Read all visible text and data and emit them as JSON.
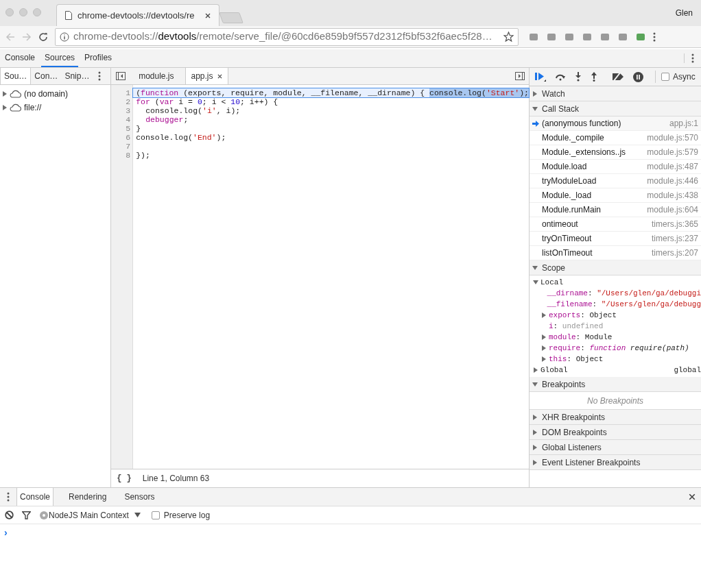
{
  "browser": {
    "tab_title": "chrome-devtools://devtools/re",
    "user": "Glen",
    "url": {
      "scheme": "chrome-devtools://",
      "host": "devtools",
      "path": "/remote/serve_file/@60cd6e859b9f557d2312f5bf532f6aec5f28…"
    }
  },
  "devtools_tabs": [
    {
      "label": "Console",
      "selected": false
    },
    {
      "label": "Sources",
      "selected": true
    },
    {
      "label": "Profiles",
      "selected": false
    }
  ],
  "navigator": {
    "tabs": [
      {
        "label": "Sou…",
        "selected": true
      },
      {
        "label": "Con…",
        "selected": false
      },
      {
        "label": "Snip…",
        "selected": false
      }
    ],
    "tree": [
      {
        "label": "(no domain)",
        "expanded": false
      },
      {
        "label": "file://",
        "expanded": false
      }
    ]
  },
  "editor": {
    "tabs": [
      {
        "label": "module.js",
        "selected": false,
        "closable": false
      },
      {
        "label": "app.js",
        "selected": true,
        "closable": true
      }
    ],
    "lines": [
      {
        "number": "1",
        "current": true,
        "indent": false,
        "tokens": [
          {
            "text": "(",
            "kind": "plain"
          },
          {
            "text": "function",
            "kind": "keyword"
          },
          {
            "text": " (exports, require, module, __filename, __dirname) { ",
            "kind": "plain"
          },
          {
            "text": "console.log(",
            "kind": "selected"
          },
          {
            "text": "'Start'",
            "kind": "selected-string"
          },
          {
            "text": ");",
            "kind": "selected"
          }
        ]
      },
      {
        "number": "2",
        "current": false,
        "indent": false,
        "tokens": [
          {
            "text": "for",
            "kind": "keyword"
          },
          {
            "text": " (",
            "kind": "plain"
          },
          {
            "text": "var",
            "kind": "keyword"
          },
          {
            "text": " i = ",
            "kind": "plain"
          },
          {
            "text": "0",
            "kind": "number"
          },
          {
            "text": "; i < ",
            "kind": "plain"
          },
          {
            "text": "10",
            "kind": "number"
          },
          {
            "text": "; i++) {",
            "kind": "plain"
          }
        ]
      },
      {
        "number": "3",
        "current": false,
        "indent": true,
        "tokens": [
          {
            "text": "console.log(",
            "kind": "plain"
          },
          {
            "text": "'i'",
            "kind": "string"
          },
          {
            "text": ", i);",
            "kind": "plain"
          }
        ]
      },
      {
        "number": "4",
        "current": false,
        "indent": true,
        "tokens": [
          {
            "text": "debugger",
            "kind": "keyword"
          },
          {
            "text": ";",
            "kind": "plain"
          }
        ]
      },
      {
        "number": "5",
        "current": false,
        "indent": false,
        "tokens": [
          {
            "text": "}",
            "kind": "plain"
          }
        ]
      },
      {
        "number": "6",
        "current": false,
        "indent": false,
        "tokens": [
          {
            "text": "console.log(",
            "kind": "plain"
          },
          {
            "text": "'End'",
            "kind": "string"
          },
          {
            "text": ");",
            "kind": "plain"
          }
        ]
      },
      {
        "number": "7",
        "current": false,
        "indent": false
      },
      {
        "number": "8",
        "current": false,
        "indent": false,
        "tokens": [
          {
            "text": "});",
            "kind": "plain"
          }
        ]
      }
    ],
    "pretty_print": "{ }",
    "status": "Line 1, Column 63"
  },
  "debugger": {
    "async_label": "Async",
    "async_checked": false,
    "watch": {
      "title": "Watch",
      "expanded": false
    },
    "call_stack": {
      "title": "Call Stack",
      "expanded": true,
      "frames": [
        {
          "name": "(anonymous function)",
          "location": "app.js:1",
          "selected": true
        },
        {
          "name": "Module._compile",
          "location": "module.js:570",
          "selected": false
        },
        {
          "name": "Module._extensions..js",
          "location": "module.js:579",
          "selected": false
        },
        {
          "name": "Module.load",
          "location": "module.js:487",
          "selected": false
        },
        {
          "name": "tryModuleLoad",
          "location": "module.js:446",
          "selected": false
        },
        {
          "name": "Module._load",
          "location": "module.js:438",
          "selected": false
        },
        {
          "name": "Module.runMain",
          "location": "module.js:604",
          "selected": false
        },
        {
          "name": "ontimeout",
          "location": "timers.js:365",
          "selected": false
        },
        {
          "name": "tryOnTimeout",
          "location": "timers.js:237",
          "selected": false
        },
        {
          "name": "listOnTimeout",
          "location": "timers.js:207",
          "selected": false
        }
      ]
    },
    "scope": {
      "title": "Scope",
      "expanded": true,
      "groups": [
        {
          "label": "Local",
          "expanded": true,
          "vars": [
            {
              "name": "__dirname",
              "separator": ":",
              "kind": "string",
              "value": "\"/Users/glen/ga/debuggi",
              "expandable": false
            },
            {
              "name": "__filename",
              "separator": ":",
              "kind": "string",
              "value": "\"/Users/glen/ga/debugg",
              "expandable": false
            },
            {
              "name": "exports",
              "separator": ":",
              "kind": "object",
              "value": "Object",
              "expandable": true
            },
            {
              "name": "i",
              "separator": ":",
              "kind": "undefined",
              "value": "undefined",
              "expandable": false
            },
            {
              "name": "module",
              "separator": ":",
              "kind": "object",
              "value": "Module",
              "expandable": true
            },
            {
              "name": "require",
              "separator": ":",
              "kind": "function",
              "keyword": "function",
              "value": "require(path)",
              "expandable": true
            },
            {
              "name": "this",
              "separator": ":",
              "kind": "object",
              "value": "Object",
              "expandable": true
            }
          ]
        },
        {
          "label": "Global",
          "expanded": false,
          "value": "global"
        }
      ]
    },
    "breakpoints": {
      "title": "Breakpoints",
      "expanded": true,
      "empty_text": "No Breakpoints"
    },
    "other_panes": [
      {
        "title": "XHR Breakpoints",
        "expanded": false
      },
      {
        "title": "DOM Breakpoints",
        "expanded": false
      },
      {
        "title": "Global Listeners",
        "expanded": false
      },
      {
        "title": "Event Listener Breakpoints",
        "expanded": false
      }
    ]
  },
  "drawer": {
    "tabs": [
      {
        "label": "Console",
        "selected": true
      },
      {
        "label": "Rendering",
        "selected": false
      },
      {
        "label": "Sensors",
        "selected": false
      }
    ],
    "context": "NodeJS Main Context",
    "preserve_log": {
      "label": "Preserve log",
      "checked": false
    },
    "prompt": "›"
  }
}
